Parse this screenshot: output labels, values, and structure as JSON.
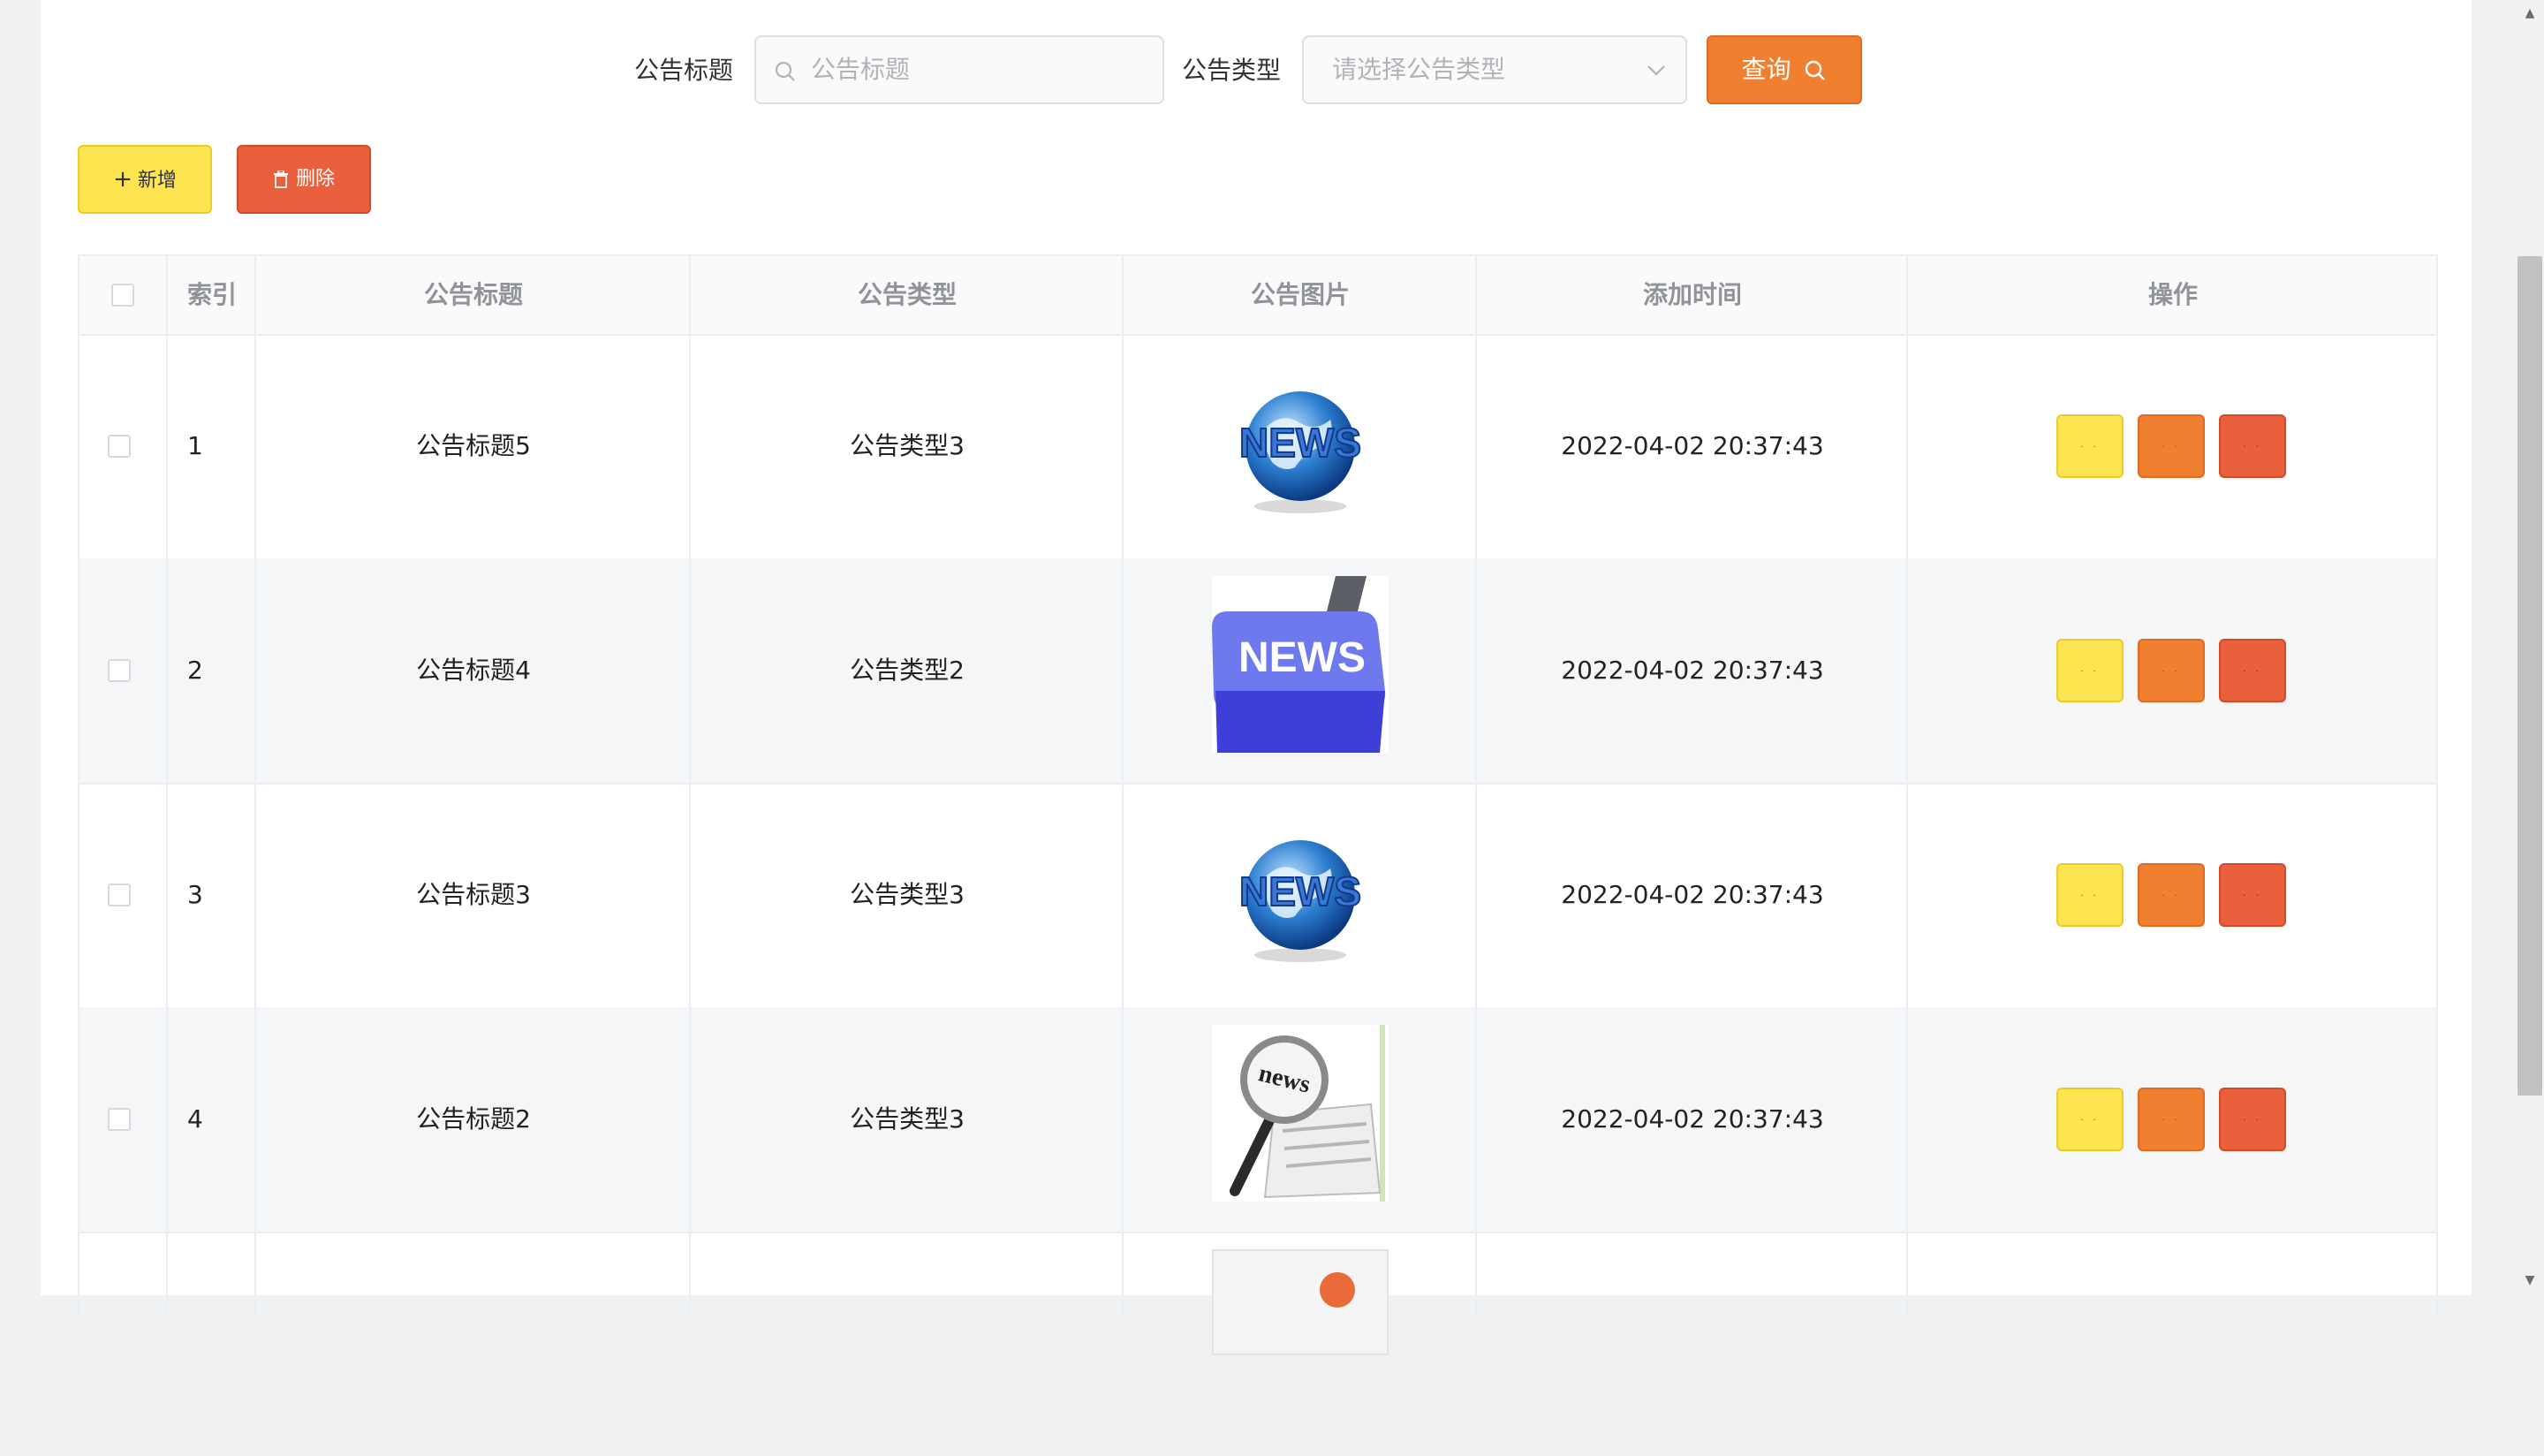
{
  "search": {
    "title_label": "公告标题",
    "title_placeholder": "公告标题",
    "type_label": "公告类型",
    "type_placeholder": "请选择公告类型",
    "query_button": "查询"
  },
  "toolbar": {
    "add_label": "新增",
    "delete_label": "删除"
  },
  "table": {
    "columns": [
      "索引",
      "公告标题",
      "公告类型",
      "公告图片",
      "添加时间",
      "操作"
    ],
    "rows": [
      {
        "index": "1",
        "title": "公告标题5",
        "type": "公告类型3",
        "image": "news-globe-image",
        "time": "2022-04-02 20:37:43"
      },
      {
        "index": "2",
        "title": "公告标题4",
        "type": "公告类型2",
        "image": "news-key-image",
        "time": "2022-04-02 20:37:43"
      },
      {
        "index": "3",
        "title": "公告标题3",
        "type": "公告类型3",
        "image": "news-globe-image",
        "time": "2022-04-02 20:37:43"
      },
      {
        "index": "4",
        "title": "公告标题2",
        "type": "公告类型3",
        "image": "news-magnifier-image",
        "time": "2022-04-02 20:37:43"
      }
    ]
  },
  "colors": {
    "yellow": "#fde552",
    "orange": "#f08030",
    "red": "#ea5f3c"
  }
}
